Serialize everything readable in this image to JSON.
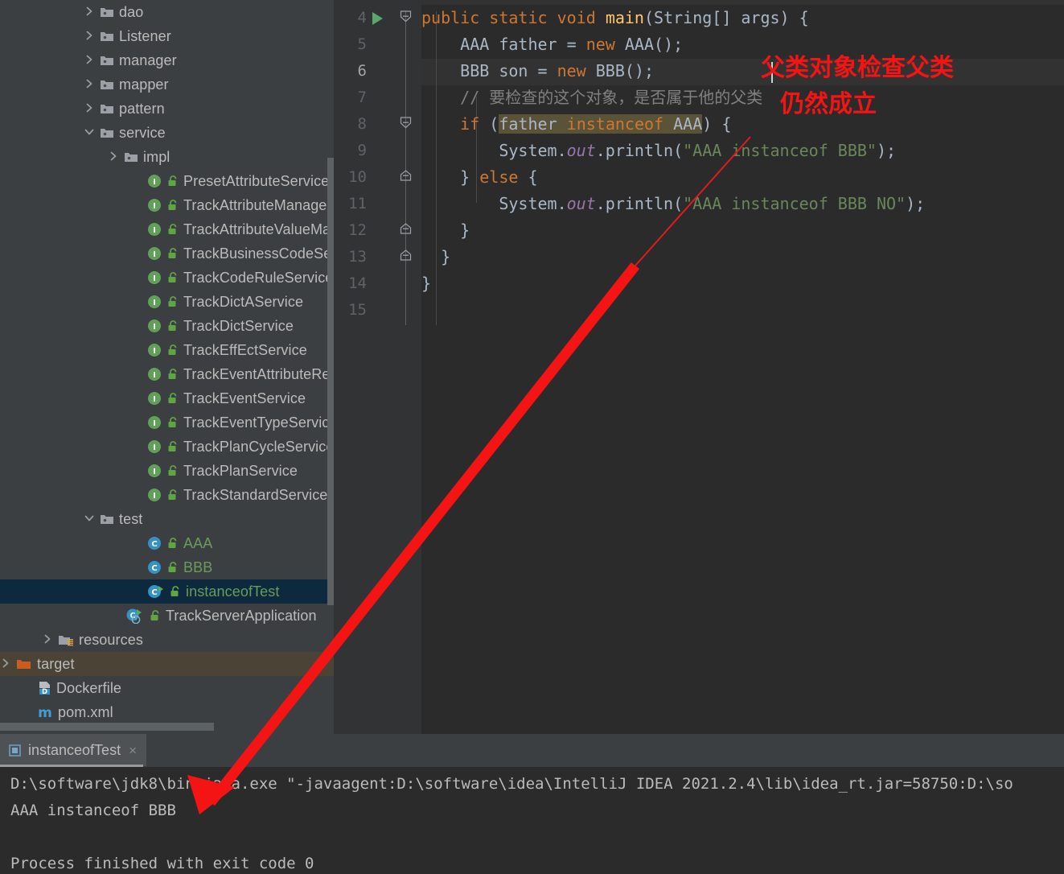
{
  "sidebar": {
    "items": [
      {
        "label": "dao",
        "icon": "folder-icon",
        "arrow": "collapsed",
        "indent": 104,
        "type": "folder"
      },
      {
        "label": "Listener",
        "icon": "folder-icon",
        "arrow": "collapsed",
        "indent": 104,
        "type": "folder"
      },
      {
        "label": "manager",
        "icon": "folder-icon",
        "arrow": "collapsed",
        "indent": 104,
        "type": "folder"
      },
      {
        "label": "mapper",
        "icon": "folder-icon",
        "arrow": "collapsed",
        "indent": 104,
        "type": "folder"
      },
      {
        "label": "pattern",
        "icon": "folder-icon",
        "arrow": "collapsed",
        "indent": 104,
        "type": "folder"
      },
      {
        "label": "service",
        "icon": "folder-icon",
        "arrow": "expanded",
        "indent": 104,
        "type": "folder"
      },
      {
        "label": "impl",
        "icon": "folder-icon",
        "arrow": "collapsed",
        "indent": 134,
        "type": "folder"
      },
      {
        "label": "PresetAttributeService",
        "icon": "interface-icon",
        "arrow": "none",
        "indent": 163,
        "type": "interface"
      },
      {
        "label": "TrackAttributeManagerService",
        "icon": "interface-icon",
        "arrow": "none",
        "indent": 163,
        "type": "interface"
      },
      {
        "label": "TrackAttributeValueManagerService",
        "icon": "interface-icon",
        "arrow": "none",
        "indent": 163,
        "type": "interface"
      },
      {
        "label": "TrackBusinessCodeService",
        "icon": "interface-icon",
        "arrow": "none",
        "indent": 163,
        "type": "interface"
      },
      {
        "label": "TrackCodeRuleService",
        "icon": "interface-icon",
        "arrow": "none",
        "indent": 163,
        "type": "interface"
      },
      {
        "label": "TrackDictAService",
        "icon": "interface-icon",
        "arrow": "none",
        "indent": 163,
        "type": "interface"
      },
      {
        "label": "TrackDictService",
        "icon": "interface-icon",
        "arrow": "none",
        "indent": 163,
        "type": "interface"
      },
      {
        "label": "TrackEffEctService",
        "icon": "interface-icon",
        "arrow": "none",
        "indent": 163,
        "type": "interface"
      },
      {
        "label": "TrackEventAttributeRelService",
        "icon": "interface-icon",
        "arrow": "none",
        "indent": 163,
        "type": "interface"
      },
      {
        "label": "TrackEventService",
        "icon": "interface-icon",
        "arrow": "none",
        "indent": 163,
        "type": "interface"
      },
      {
        "label": "TrackEventTypeService",
        "icon": "interface-icon",
        "arrow": "none",
        "indent": 163,
        "type": "interface"
      },
      {
        "label": "TrackPlanCycleService",
        "icon": "interface-icon",
        "arrow": "none",
        "indent": 163,
        "type": "interface"
      },
      {
        "label": "TrackPlanService",
        "icon": "interface-icon",
        "arrow": "none",
        "indent": 163,
        "type": "interface"
      },
      {
        "label": "TrackStandardService",
        "icon": "interface-icon",
        "arrow": "none",
        "indent": 163,
        "type": "interface"
      },
      {
        "label": "test",
        "icon": "folder-icon",
        "arrow": "expanded",
        "indent": 104,
        "type": "folder"
      },
      {
        "label": "AAA",
        "icon": "class-icon",
        "arrow": "none",
        "indent": 163,
        "type": "class"
      },
      {
        "label": "BBB",
        "icon": "class-icon",
        "arrow": "none",
        "indent": 163,
        "type": "class"
      },
      {
        "label": "instanceofTest",
        "icon": "runnable-class-icon",
        "arrow": "none",
        "indent": 163,
        "type": "runnable-class",
        "selected": true
      },
      {
        "label": "TrackServerApplication",
        "icon": "spring-boot-class-icon",
        "arrow": "none",
        "indent": 137,
        "type": "spring-class"
      },
      {
        "label": "resources",
        "icon": "resources-folder-icon",
        "arrow": "collapsed",
        "indent": 52,
        "type": "resource-folder"
      },
      {
        "label": "target",
        "icon": "excluded-folder-icon",
        "arrow": "collapsed",
        "indent": 0,
        "type": "excluded-folder",
        "highlight": "target"
      },
      {
        "label": "Dockerfile",
        "icon": "docker-file-icon",
        "arrow": "none",
        "indent": 26,
        "type": "file"
      },
      {
        "label": "pom.xml",
        "icon": "maven-file-icon",
        "arrow": "none",
        "indent": 26,
        "type": "file"
      }
    ]
  },
  "editor": {
    "first_line_number": 4,
    "line_numbers": [
      4,
      5,
      6,
      7,
      8,
      9,
      10,
      11,
      12,
      13,
      14,
      15
    ],
    "current_line": 6,
    "run_marker_line": 4,
    "lines": [
      {
        "num": 4,
        "tokens": [
          {
            "t": "public",
            "c": "kw"
          },
          {
            "t": " ",
            "c": "ident"
          },
          {
            "t": "static",
            "c": "kw"
          },
          {
            "t": " ",
            "c": "ident"
          },
          {
            "t": "void",
            "c": "kw"
          },
          {
            "t": " ",
            "c": "ident"
          },
          {
            "t": "main",
            "c": "mname"
          },
          {
            "t": "(String[] args) {",
            "c": "ident"
          }
        ]
      },
      {
        "num": 5,
        "tokens": [
          {
            "t": "    AAA father = ",
            "c": "ident"
          },
          {
            "t": "new",
            "c": "kw"
          },
          {
            "t": " AAA();",
            "c": "ident"
          }
        ]
      },
      {
        "num": 6,
        "tokens": [
          {
            "t": "    BBB son = ",
            "c": "ident"
          },
          {
            "t": "new",
            "c": "kw"
          },
          {
            "t": " BBB();",
            "c": "ident"
          }
        ]
      },
      {
        "num": 7,
        "tokens": [
          {
            "t": "    // 要检查的这个对象，是否属于他的父类",
            "c": "cmt"
          }
        ]
      },
      {
        "num": 8,
        "tokens": [
          {
            "t": "    ",
            "c": "ident"
          },
          {
            "t": "if",
            "c": "kw"
          },
          {
            "t": " (",
            "c": "ident"
          },
          {
            "t": "father ",
            "c": "hl-ident"
          },
          {
            "t": "instanceof",
            "c": "hl-kw"
          },
          {
            "t": " AAA",
            "c": "hl-ident"
          },
          {
            "t": ") {",
            "c": "ident"
          }
        ]
      },
      {
        "num": 9,
        "tokens": [
          {
            "t": "        System.",
            "c": "ident"
          },
          {
            "t": "out",
            "c": "fld"
          },
          {
            "t": ".println(",
            "c": "ident"
          },
          {
            "t": "\"AAA instanceof BBB\"",
            "c": "str"
          },
          {
            "t": ");",
            "c": "ident"
          }
        ]
      },
      {
        "num": 10,
        "tokens": [
          {
            "t": "    } ",
            "c": "ident"
          },
          {
            "t": "else",
            "c": "kw"
          },
          {
            "t": " {",
            "c": "ident"
          }
        ]
      },
      {
        "num": 11,
        "tokens": [
          {
            "t": "        System.",
            "c": "ident"
          },
          {
            "t": "out",
            "c": "fld"
          },
          {
            "t": ".println(",
            "c": "ident"
          },
          {
            "t": "\"AAA instanceof BBB NO\"",
            "c": "str"
          },
          {
            "t": ");",
            "c": "ident"
          }
        ]
      },
      {
        "num": 12,
        "tokens": [
          {
            "t": "    }",
            "c": "ident"
          }
        ]
      },
      {
        "num": 13,
        "tokens": [
          {
            "t": "  }",
            "c": "ident"
          }
        ]
      },
      {
        "num": 14,
        "tokens": [
          {
            "t": "}",
            "c": "ident"
          }
        ]
      },
      {
        "num": 15,
        "tokens": [
          {
            "t": "",
            "c": "ident"
          }
        ]
      }
    ]
  },
  "run_panel": {
    "tab_label": "instanceofTest",
    "tab_close_glyph": "×",
    "console_lines": [
      "D:\\software\\jdk8\\bin\\java.exe \"-javaagent:D:\\software\\idea\\IntelliJ IDEA 2021.2.4\\lib\\idea_rt.jar=58750:D:\\so",
      "AAA instanceof BBB",
      "",
      "Process finished with exit code 0"
    ]
  },
  "annotations": {
    "color": "#f41414",
    "note_line_1": "父类对象检查父类",
    "note_line_2": "仍然成立"
  },
  "colors": {
    "sidebar_bg": "#3c3f41",
    "editor_bg": "#2b2b2b",
    "gutter_bg": "#313335",
    "selection_bg": "#0d293e",
    "target_row_bg": "#4a4336",
    "keyword": "#cc7832",
    "method_name": "#ffc66d",
    "string": "#6a8759",
    "comment": "#808080",
    "field": "#9876aa",
    "text": "#a9b7c6",
    "annotation_red": "#f41414",
    "run_green": "#59a869"
  }
}
